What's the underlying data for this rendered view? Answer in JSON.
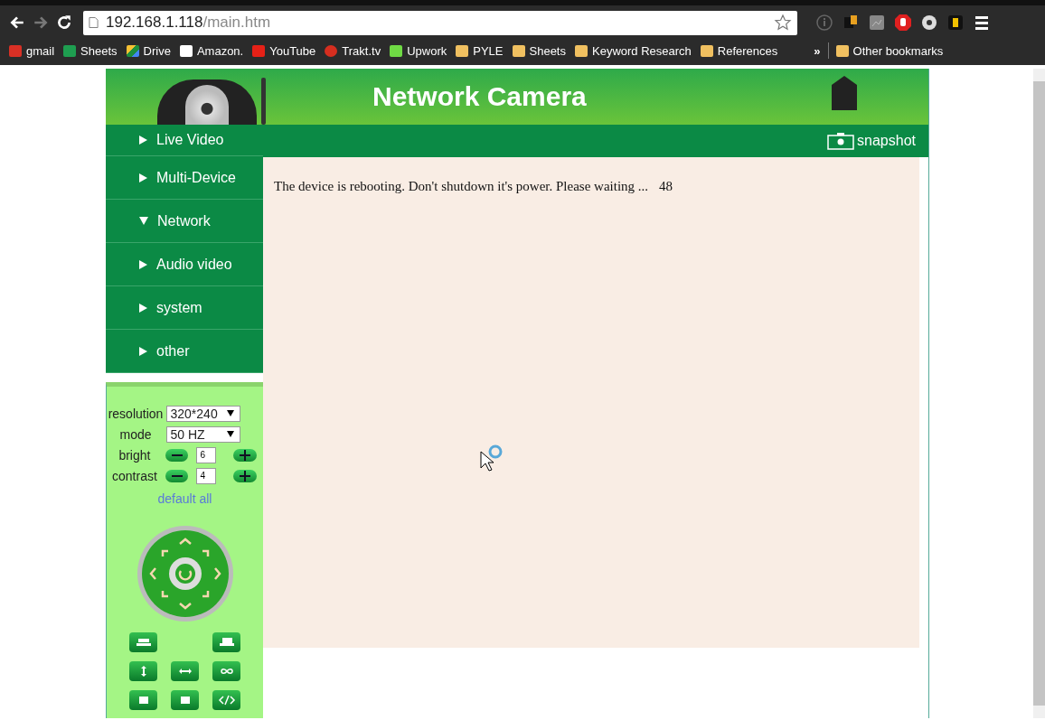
{
  "browser": {
    "url_host": "192.168.1.118",
    "url_path": "/main.htm",
    "bookmarks": [
      {
        "label": "gmail",
        "kind": "gmail"
      },
      {
        "label": "Sheets",
        "kind": "sheets"
      },
      {
        "label": "Drive",
        "kind": "drive"
      },
      {
        "label": "Amazon.",
        "kind": "amazon"
      },
      {
        "label": "YouTube",
        "kind": "youtube"
      },
      {
        "label": "Trakt.tv",
        "kind": "trakt"
      },
      {
        "label": "Upwork",
        "kind": "upwork"
      },
      {
        "label": "PYLE",
        "kind": "folder"
      },
      {
        "label": "Sheets",
        "kind": "folder"
      },
      {
        "label": "Keyword Research",
        "kind": "folder"
      },
      {
        "label": "References",
        "kind": "folder"
      }
    ],
    "overflow": "»",
    "other_bookmarks": "Other bookmarks"
  },
  "header": {
    "title": "Network Camera",
    "snapshot": "snapshot"
  },
  "menu": [
    {
      "label": "Live Video",
      "expanded": false
    },
    {
      "label": "Multi-Device",
      "expanded": false
    },
    {
      "label": "Network",
      "expanded": true
    },
    {
      "label": "Audio video",
      "expanded": false
    },
    {
      "label": "system",
      "expanded": false
    },
    {
      "label": "other",
      "expanded": false
    }
  ],
  "controls": {
    "resolution_label": "resolution",
    "resolution": "320*240",
    "mode_label": "mode",
    "mode": "50 HZ",
    "bright_label": "bright",
    "bright": "6",
    "contrast_label": "contrast",
    "contrast": "4",
    "default_link": "default all"
  },
  "message": {
    "text": "The device is rebooting. Don't shutdown it's power. Please waiting ...",
    "countdown": "48"
  }
}
